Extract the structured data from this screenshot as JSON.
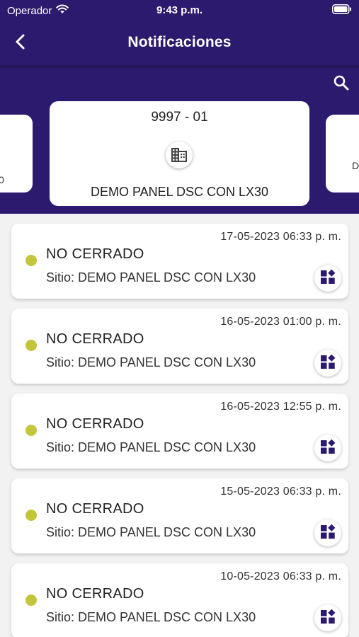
{
  "status_bar": {
    "carrier": "Operador",
    "time": "9:43 p.m."
  },
  "header": {
    "title": "Notificaciones",
    "back_icon": "chevron-left-icon",
    "search_icon": "search-icon"
  },
  "sites": {
    "left_peek_text": "0",
    "right_peek_text": "D",
    "selected": {
      "code": "9997 - 01",
      "icon": "building-icon",
      "name": "DEMO PANEL DSC CON LX30"
    }
  },
  "colors": {
    "header_bg": "#2c1a6e",
    "status_dot": "#c3c63a",
    "accent_icon": "#2c1a6e"
  },
  "notifications": [
    {
      "date": "17-05-2023 06:33 p. m.",
      "status": "NO CERRADO",
      "site": "Sitio: DEMO PANEL DSC CON LX30"
    },
    {
      "date": "16-05-2023 01:00 p. m.",
      "status": "NO CERRADO",
      "site": "Sitio: DEMO PANEL DSC CON LX30"
    },
    {
      "date": "16-05-2023 12:55 p. m.",
      "status": "NO CERRADO",
      "site": "Sitio: DEMO PANEL DSC CON LX30"
    },
    {
      "date": "15-05-2023 06:33 p. m.",
      "status": "NO CERRADO",
      "site": "Sitio: DEMO PANEL DSC CON LX30"
    },
    {
      "date": "10-05-2023 06:33 p. m.",
      "status": "NO CERRADO",
      "site": "Sitio: DEMO PANEL DSC CON LX30"
    }
  ]
}
